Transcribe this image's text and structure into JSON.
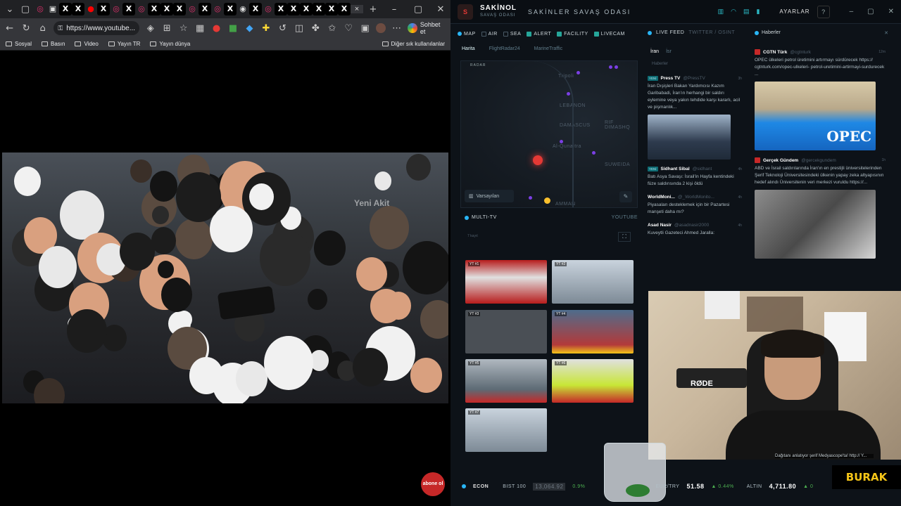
{
  "browser": {
    "tabs": [
      {
        "kind": "ig",
        "icon": "◎"
      },
      {
        "kind": "w",
        "icon": "▣"
      },
      {
        "kind": "x",
        "icon": "X"
      },
      {
        "kind": "x",
        "icon": "X"
      },
      {
        "kind": "yt",
        "icon": "●"
      },
      {
        "kind": "x",
        "icon": "X"
      },
      {
        "kind": "ig",
        "icon": "◎"
      },
      {
        "kind": "x",
        "icon": "X"
      },
      {
        "kind": "ig",
        "icon": "◎"
      },
      {
        "kind": "x",
        "icon": "X"
      },
      {
        "kind": "x",
        "icon": "X"
      },
      {
        "kind": "x",
        "icon": "X"
      },
      {
        "kind": "ig",
        "icon": "◎"
      },
      {
        "kind": "x",
        "icon": "X"
      },
      {
        "kind": "ig",
        "icon": "◎"
      },
      {
        "kind": "x",
        "icon": "X"
      },
      {
        "kind": "w",
        "icon": "◉"
      },
      {
        "kind": "x",
        "icon": "X"
      },
      {
        "kind": "ig",
        "icon": "◎"
      },
      {
        "kind": "x",
        "icon": "X"
      },
      {
        "kind": "x",
        "icon": "X"
      },
      {
        "kind": "x",
        "icon": "X"
      },
      {
        "kind": "x",
        "icon": "X"
      },
      {
        "kind": "x",
        "icon": "X"
      },
      {
        "kind": "x",
        "icon": "X"
      }
    ],
    "active_tab_close": "×",
    "new_tab": "+",
    "url": "https://www.youtube...",
    "chat_label": "Sohbet et",
    "bookmarks": [
      "Sosyal",
      "Basın",
      "Video",
      "Yayın TR",
      "Yayın dünya"
    ],
    "other_bookmarks": "Diğer sık kullanılanlar",
    "watermark": "abone ol",
    "video_overlay": "Yeni Akit"
  },
  "dashboard": {
    "brand": "SAKİNOL",
    "brand_sub": "SAVAŞ ODASI",
    "title": "SAKİNLER SAVAŞ ODASI",
    "settings": "AYARLAR",
    "help": "?",
    "filters": [
      {
        "label": "MAP",
        "on": false,
        "dot": true
      },
      {
        "label": "AIR",
        "on": false
      },
      {
        "label": "SEA",
        "on": false
      },
      {
        "label": "ALERT",
        "on": true
      },
      {
        "label": "FACILITY",
        "on": true
      },
      {
        "label": "LIVECAM",
        "on": true
      }
    ],
    "map_tabs": [
      "Harita",
      "FlightRadar24",
      "MarineTraffic"
    ],
    "radar": "RADAR",
    "map_labels": [
      "LEBANON",
      "DAMASCUS",
      "RIF DIMASHQ",
      "Al-Qunaitra",
      "SUWEIDA",
      "AMMAN",
      "Tripoli"
    ],
    "preset": "Varsayılan",
    "multitv": {
      "title": "MULTI-TV",
      "source": "YOUTUBE",
      "count": "7 kayıt"
    },
    "tv_labels": [
      "YT #1",
      "YT #2",
      "YT #3",
      "YT #4",
      "YT #5",
      "YT #6",
      "YT #7"
    ],
    "feed": {
      "title": "LIVE FEED",
      "source": "TWITTER / OSINT",
      "tabs": [
        "İran",
        "İsr"
      ],
      "subtab": "Haberler",
      "items": [
        {
          "badge": "YENİ",
          "name": "Press TV",
          "handle": "@PressTV",
          "time": "3h",
          "text": "İran Dışişleri Bakan Yardımcısı Kazım Garibabadi, İran'ın herhangi bir saldırı eylemine veya yakın tehdide karşı kararlı, acil ve pişmanlık..."
        },
        {
          "badge": "YENİ",
          "name": "Sidhant Sibal",
          "handle": "@sidhant",
          "time": "4h",
          "text": "Batı Asya Savaşı: İsrail'in Hayfa kentindeki füze saldırısında 2 kişi öldü"
        },
        {
          "badge": "",
          "name": "WorldMoni...",
          "handle": "@_WorldMonito...",
          "time": "4h",
          "text": "Piyasaları desteklemek için bir Pazartesi manşeti daha mı?"
        },
        {
          "badge": "",
          "name": "Asad Nasir",
          "handle": "@asadnasir2000",
          "time": "4h",
          "text": "Kuveytli Gazeteci Ahmed Jaralla:"
        }
      ]
    },
    "news": {
      "title": "Haberler",
      "items": [
        {
          "name": "CGTN Türk",
          "handle": "@cgtnturk",
          "time": "12m",
          "text": "OPEC ülkeleri petrol üretimini artırmayı sürdürecek https:// cgtnturk.com/opec-ulkeleri- petrol-uretimini-artirmayi-surdurecek ...",
          "img_label": "OPEC"
        },
        {
          "name": "Gerçek Gündem",
          "handle": "@gercekgundem",
          "time": "1h",
          "text": "ABD ve İsrail saldırılarında İran'ın en prestijli üniversitelerinden Şerif Teknoloji Üniversitesindeki ülkenin yapay zeka altyapısının hedef alındı Üniversitenin veri merkezi vuruldu https://..."
        }
      ]
    },
    "webcam_badge": "BURAK",
    "mic_label": "RØDE",
    "ticker": {
      "label": "ECON",
      "bist_label": "BIST 100",
      "bist_value": "13,064.92",
      "bist_change": "0.9%",
      "eur_label": "EUR/TRY",
      "eur_value": "51.58",
      "eur_change": "▲ 0.44%",
      "gold_label": "ALTIN",
      "gold_value": "4,711.80",
      "gold_change": "▲ 0",
      "overlay_text": "Dağıtanı anlatıyor şerif  Medyascope'ta! http:// Y..."
    }
  },
  "colors": {
    "accent": "#2bb8c4",
    "alert": "#e53935",
    "badge": "#0e6b73"
  }
}
